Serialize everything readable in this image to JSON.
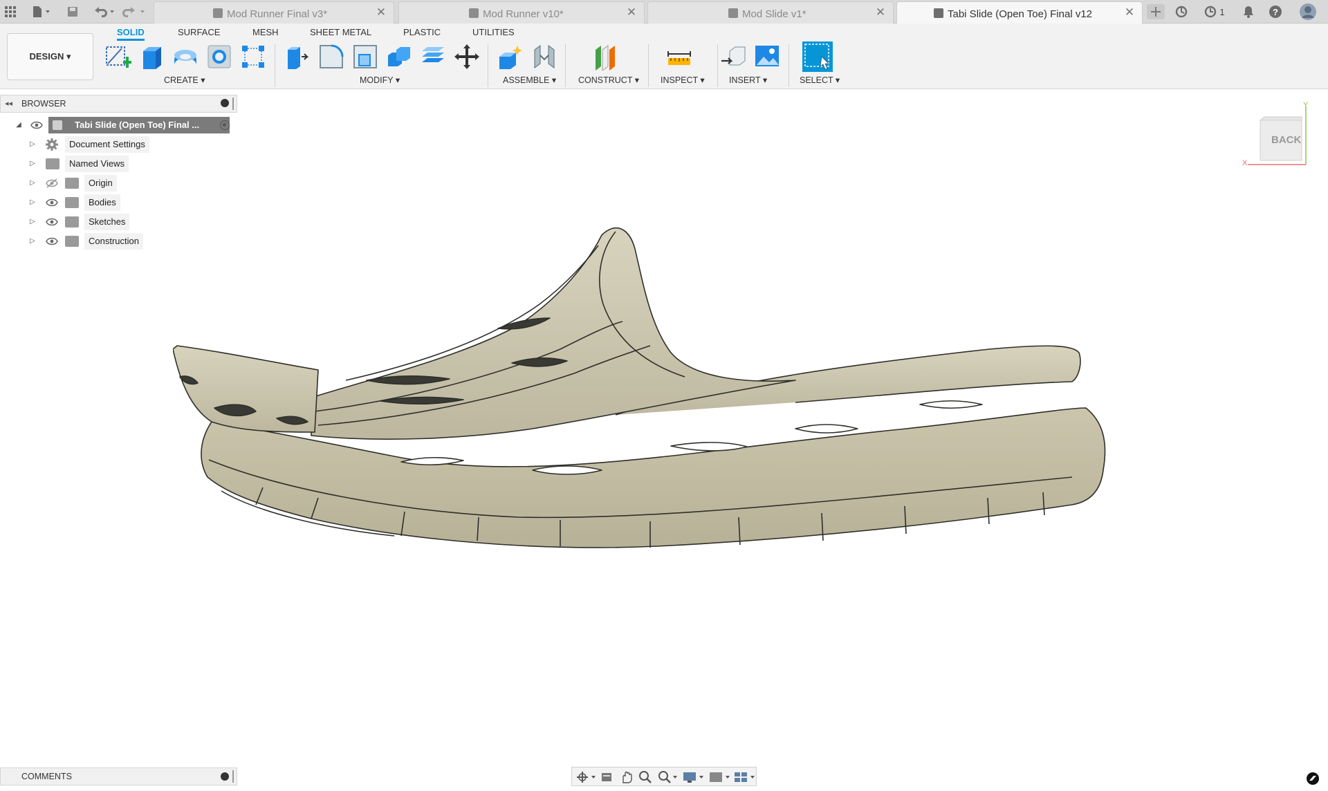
{
  "tabs": [
    {
      "title": "Mod Runner Final v3*",
      "active": false
    },
    {
      "title": "Mod Runner v10*",
      "active": false
    },
    {
      "title": "Mod Slide v1*",
      "active": false
    },
    {
      "title": "Tabi Slide (Open Toe) Final v12",
      "active": true
    }
  ],
  "header": {
    "job_count": "1"
  },
  "workspace": {
    "label": "DESIGN ▾"
  },
  "ribbon_tabs": [
    "SOLID",
    "SURFACE",
    "MESH",
    "SHEET METAL",
    "PLASTIC",
    "UTILITIES"
  ],
  "groups": {
    "create": "CREATE ▾",
    "modify": "MODIFY ▾",
    "assemble": "ASSEMBLE ▾",
    "construct": "CONSTRUCT ▾",
    "inspect": "INSPECT ▾",
    "insert": "INSERT ▾",
    "select": "SELECT ▾"
  },
  "browser": {
    "title": "BROWSER",
    "root": "Tabi Slide (Open Toe) Final ...",
    "items": [
      {
        "label": "Document Settings",
        "icon": "gear-icon"
      },
      {
        "label": "Named Views",
        "icon": "folder-icon"
      },
      {
        "label": "Origin",
        "icon": "folder-icon",
        "hidden": true
      },
      {
        "label": "Bodies",
        "icon": "folder-icon"
      },
      {
        "label": "Sketches",
        "icon": "folder-icon"
      },
      {
        "label": "Construction",
        "icon": "folder-icon"
      }
    ]
  },
  "viewcube": {
    "face": "BACK",
    "axis_x": "X",
    "axis_y": "Y"
  },
  "comments": {
    "title": "COMMENTS"
  },
  "colors": {
    "accent": "#0696d7",
    "model": "#cdc7b1",
    "model_edge": "#2e2e2a"
  }
}
